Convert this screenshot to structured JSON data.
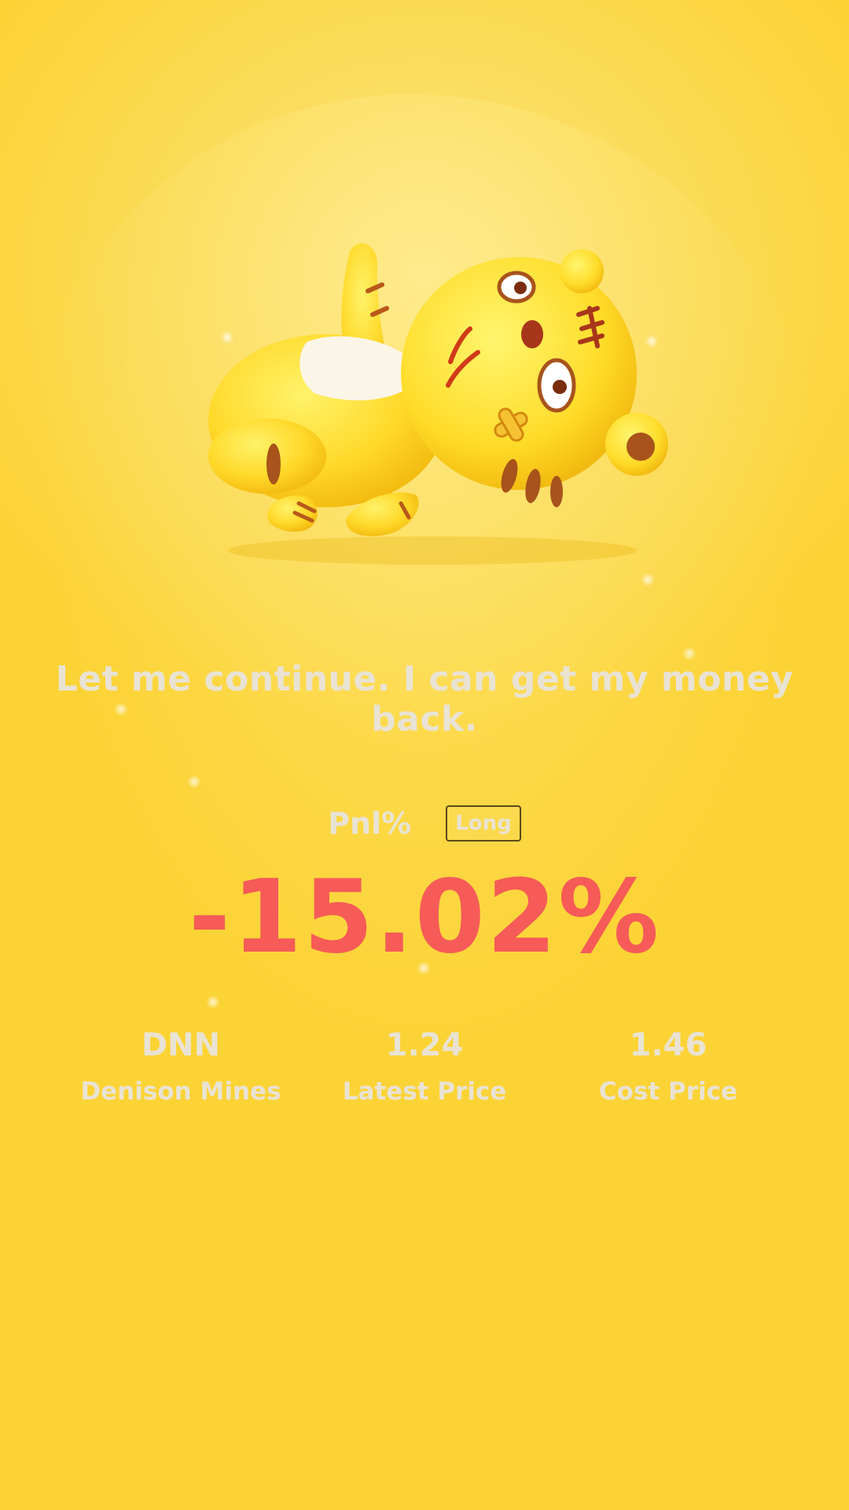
{
  "slogan": "Let me continue. I can get my money back.",
  "pnl": {
    "label": "Pnl%",
    "side": "Long",
    "value": "-15.02%"
  },
  "stats": [
    {
      "value": "DNN",
      "label": "Denison Mines"
    },
    {
      "value": "1.24",
      "label": "Latest Price"
    },
    {
      "value": "1.46",
      "label": "Cost Price"
    }
  ],
  "colors": {
    "background": "#fcd335",
    "loss": "#f65b57",
    "text": "#e9e3d4"
  },
  "mascot": "sleeping-tiger-mascot-icon"
}
